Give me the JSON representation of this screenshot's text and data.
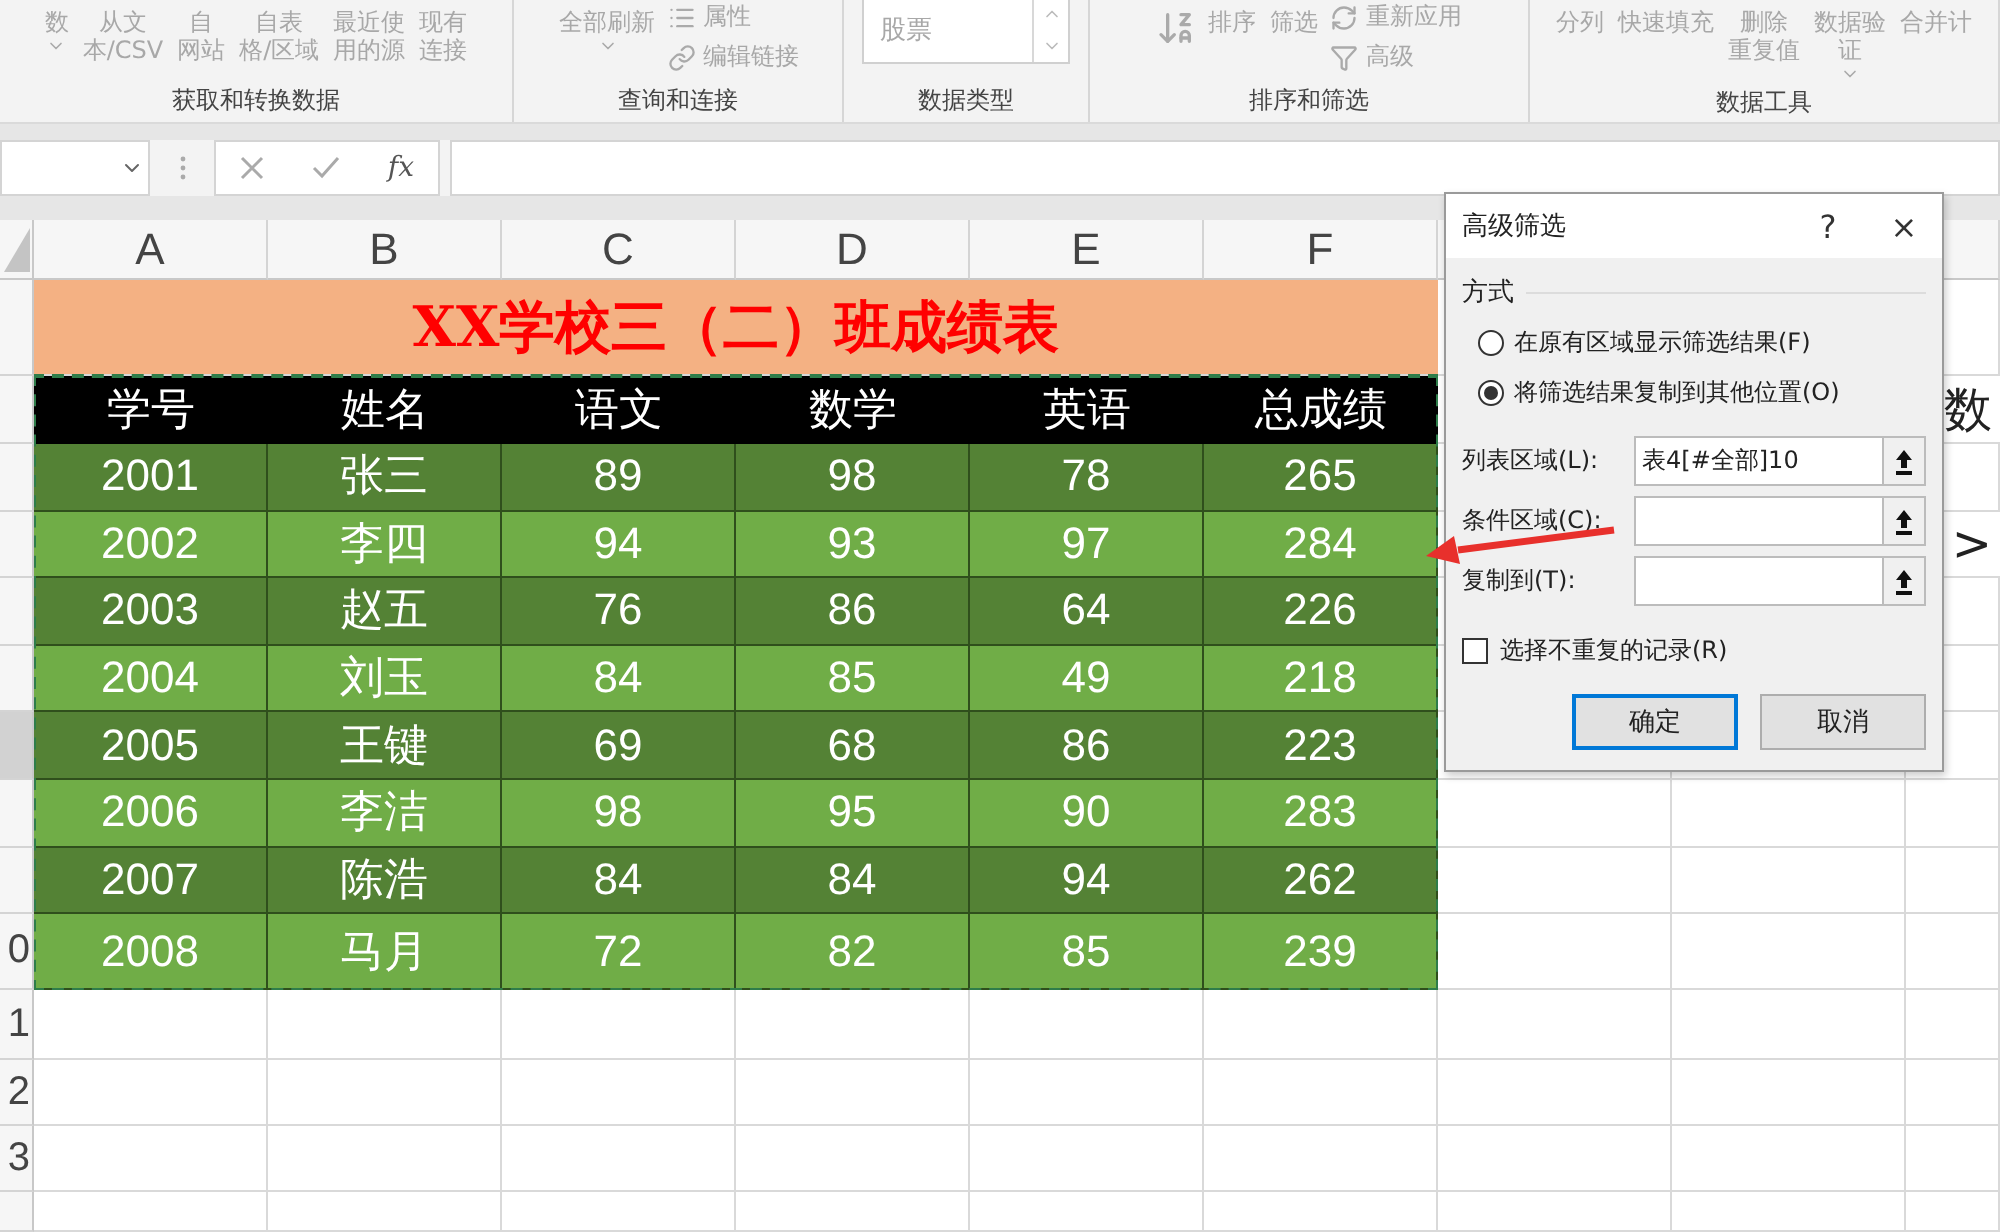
{
  "ribbon": {
    "groups": [
      {
        "label": "获取和转换数据",
        "items": [
          {
            "kind": "dropdown",
            "lines": [
              "数"
            ]
          },
          {
            "kind": "large",
            "lines": [
              "从文",
              "本/CSV"
            ]
          },
          {
            "kind": "large",
            "lines": [
              "自",
              "网站"
            ]
          },
          {
            "kind": "large",
            "lines": [
              "自表",
              "格/区域"
            ]
          },
          {
            "kind": "large",
            "lines": [
              "最近使",
              "用的源"
            ]
          },
          {
            "kind": "large",
            "lines": [
              "现有",
              "连接"
            ]
          }
        ]
      },
      {
        "label": "查询和连接",
        "items": [
          {
            "kind": "dropdown",
            "lines": [
              "全部刷新"
            ]
          },
          {
            "kind": "stack",
            "entries": [
              {
                "label": "属性"
              },
              {
                "label": "编辑链接"
              }
            ]
          }
        ]
      },
      {
        "label": "数据类型",
        "items": [
          {
            "kind": "combo",
            "value": "股票"
          }
        ]
      },
      {
        "label": "排序和筛选",
        "items": [
          {
            "kind": "sort",
            "lines": [
              "排序"
            ]
          },
          {
            "kind": "large",
            "lines": [
              "筛选"
            ]
          },
          {
            "kind": "stack",
            "entries": [
              {
                "label": "重新应用"
              },
              {
                "label": "高级"
              }
            ]
          }
        ]
      },
      {
        "label": "数据工具",
        "items": [
          {
            "kind": "large",
            "lines": [
              "分列"
            ]
          },
          {
            "kind": "large",
            "lines": [
              "快速填充"
            ]
          },
          {
            "kind": "large",
            "lines": [
              "删除",
              "重复值"
            ]
          },
          {
            "kind": "dropdown",
            "lines": [
              "数据验",
              "证"
            ]
          },
          {
            "kind": "large",
            "lines": [
              "合并计"
            ]
          }
        ]
      }
    ]
  },
  "formula_bar": {
    "fx": "fx"
  },
  "sheet": {
    "columns": [
      "A",
      "B",
      "C",
      "D",
      "E",
      "F"
    ],
    "title": "XX学校三（二）班成绩表",
    "headers": [
      "学号",
      "姓名",
      "语文",
      "数学",
      "英语",
      "总成绩"
    ],
    "rows": [
      {
        "cells": [
          "2001",
          "张三",
          "89",
          "98",
          "78",
          "265"
        ],
        "active": false
      },
      {
        "cells": [
          "2002",
          "李四",
          "94",
          "93",
          "97",
          "284"
        ],
        "active": false
      },
      {
        "cells": [
          "2003",
          "赵五",
          "76",
          "86",
          "64",
          "226"
        ],
        "active": false
      },
      {
        "cells": [
          "2004",
          "刘玉",
          "84",
          "85",
          "49",
          "218"
        ],
        "active": false
      },
      {
        "cells": [
          "2005",
          "王键",
          "69",
          "68",
          "86",
          "223"
        ],
        "active": true
      },
      {
        "cells": [
          "2006",
          "李洁",
          "98",
          "95",
          "90",
          "283"
        ],
        "active": false
      },
      {
        "cells": [
          "2007",
          "陈浩",
          "84",
          "84",
          "94",
          "262"
        ],
        "active": false
      },
      {
        "cells": [
          "2008",
          "马月",
          "72",
          "82",
          "85",
          "239"
        ],
        "active": false
      }
    ],
    "row_number_tails": [
      "0",
      "1",
      "2",
      "3"
    ],
    "side_cells": [
      {
        "text": "数"
      },
      {
        "text": ">"
      }
    ]
  },
  "dialog": {
    "title": "高级筛选",
    "help": "?",
    "close": "×",
    "section": "方式",
    "options": [
      {
        "label": "在原有区域显示筛选结果(F)",
        "selected": false
      },
      {
        "label": "将筛选结果复制到其他位置(O)",
        "selected": true
      }
    ],
    "fields": [
      {
        "label": "列表区域(L):",
        "value": "表4[#全部]10"
      },
      {
        "label": "条件区域(C):"
      },
      {
        "label": "复制到(T):"
      }
    ],
    "unique": {
      "label": "选择不重复的记录(R)",
      "checked": false
    },
    "buttons": [
      {
        "label": "确定",
        "default": true
      },
      {
        "label": "取消",
        "default": false
      }
    ]
  }
}
